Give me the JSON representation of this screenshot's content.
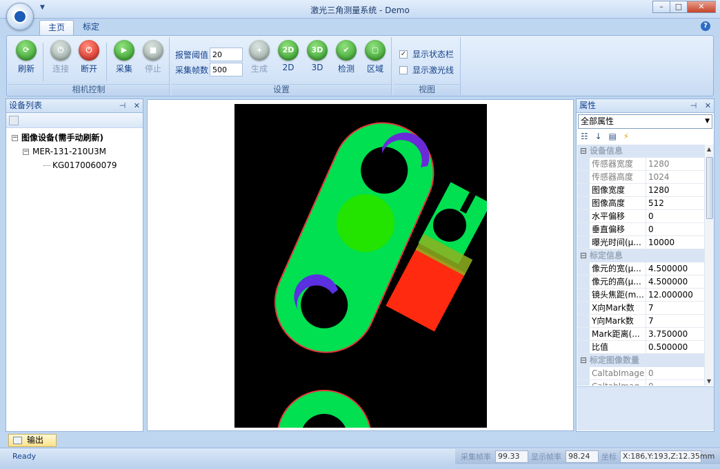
{
  "window": {
    "title": "激光三角测量系统 - Demo",
    "minimize": "–",
    "maximize": "□",
    "close": "✕"
  },
  "ribbon": {
    "tabs": [
      "主页",
      "标定"
    ],
    "groups": {
      "camera": {
        "label": "相机控制",
        "buttons": {
          "refresh": "刷新",
          "connect": "连接",
          "disconnect": "断开",
          "capture": "采集",
          "stop": "停止"
        }
      },
      "settings": {
        "label": "设置",
        "alarm_label": "报警阈值",
        "alarm_value": "20",
        "frames_label": "采集帧数",
        "frames_value": "500",
        "buttons": {
          "generate": "生成",
          "b2d": "2D",
          "b3d": "3D",
          "detect": "检测",
          "region": "区域"
        },
        "icons": {
          "b2d": "2D",
          "b3d": "3D"
        }
      },
      "view": {
        "label": "视图",
        "show_status": "显示状态栏",
        "show_laser": "显示激光线"
      }
    }
  },
  "device_panel": {
    "title": "设备列表",
    "pin": "⊣",
    "close": "✕",
    "tree": {
      "root": "图像设备(需手动刷新)",
      "camera": "MER-131-210U3M",
      "serial": "KG0170060079"
    }
  },
  "properties": {
    "title": "属性",
    "pin": "⊣",
    "close": "✕",
    "select": "全部属性",
    "categories": {
      "device_info": "设备信息",
      "calib_info": "标定信息",
      "calib_count": "标定图像数量"
    },
    "rows": [
      {
        "name": "传感器宽度",
        "value": "1280"
      },
      {
        "name": "传感器高度",
        "value": "1024"
      },
      {
        "name": "图像宽度",
        "value": "1280"
      },
      {
        "name": "图像高度",
        "value": "512"
      },
      {
        "name": "水平偏移",
        "value": "0"
      },
      {
        "name": "垂直偏移",
        "value": "0"
      },
      {
        "name": "曝光时间(μ...",
        "value": "10000"
      },
      {
        "name": "像元的宽(μ...",
        "value": "4.500000"
      },
      {
        "name": "像元的高(μ...",
        "value": "4.500000"
      },
      {
        "name": "镜头焦距(m...",
        "value": "12.000000"
      },
      {
        "name": "X向Mark数",
        "value": "7"
      },
      {
        "name": "Y向Mark数",
        "value": "7"
      },
      {
        "name": "Mark距离(...",
        "value": "3.750000"
      },
      {
        "name": "比值",
        "value": "0.500000"
      },
      {
        "name": "CaltabImage",
        "value": "0"
      },
      {
        "name": "CaltabImag...",
        "value": "0"
      }
    ]
  },
  "output": {
    "tab": "输出"
  },
  "status": {
    "ready": "Ready",
    "capture_fps_label": "采集帧率",
    "capture_fps": "99.33",
    "display_fps_label": "显示帧率",
    "display_fps": "98.24",
    "coord_label": "坐标",
    "coord": "X:186,Y:193,Z:12.35mm"
  }
}
